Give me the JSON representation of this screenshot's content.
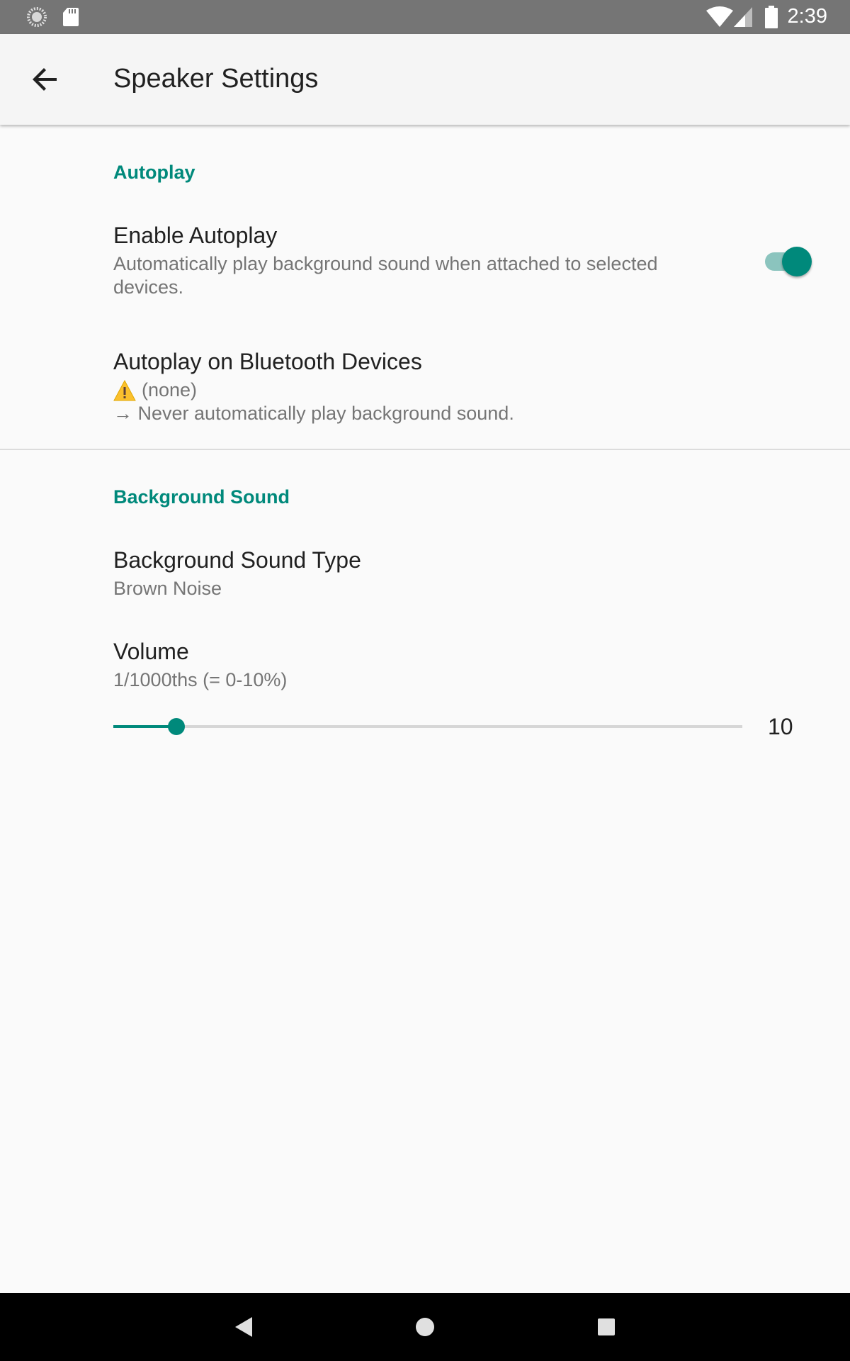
{
  "status_bar": {
    "time": "2:39",
    "left_icons": [
      "loading-icon",
      "sd-card-icon"
    ],
    "right_icons": [
      "wifi-icon",
      "cell-signal-icon",
      "battery-icon"
    ]
  },
  "app_bar": {
    "title": "Speaker Settings",
    "back_icon": "arrow-back-icon"
  },
  "sections": {
    "autoplay": {
      "header": "Autoplay",
      "enable_autoplay": {
        "title": "Enable Autoplay",
        "summary_line1": "Automatically play background sound when attached to selected",
        "summary_line2": "devices.",
        "checked": true
      },
      "bluetooth_devices": {
        "title": "Autoplay on Bluetooth Devices",
        "status_icon": "warning-icon",
        "status_text": "(none)",
        "detail_arrow": "→",
        "detail_text": "Never automatically play background sound."
      }
    },
    "background_sound": {
      "header": "Background Sound",
      "sound_type": {
        "title": "Background Sound Type",
        "value": "Brown Noise"
      },
      "volume": {
        "title": "Volume",
        "summary": "1/1000ths (= 0-10%)",
        "value": "10",
        "value_fraction": 0.1
      }
    }
  },
  "nav_bar": {
    "icons": [
      "nav-back-icon",
      "nav-home-icon",
      "nav-recents-icon"
    ]
  },
  "colors": {
    "accent": "#00897b",
    "accent_light": "#8bc4be",
    "status_bar": "#757575",
    "app_bar": "#f5f5f5",
    "background": "#fafafa"
  }
}
